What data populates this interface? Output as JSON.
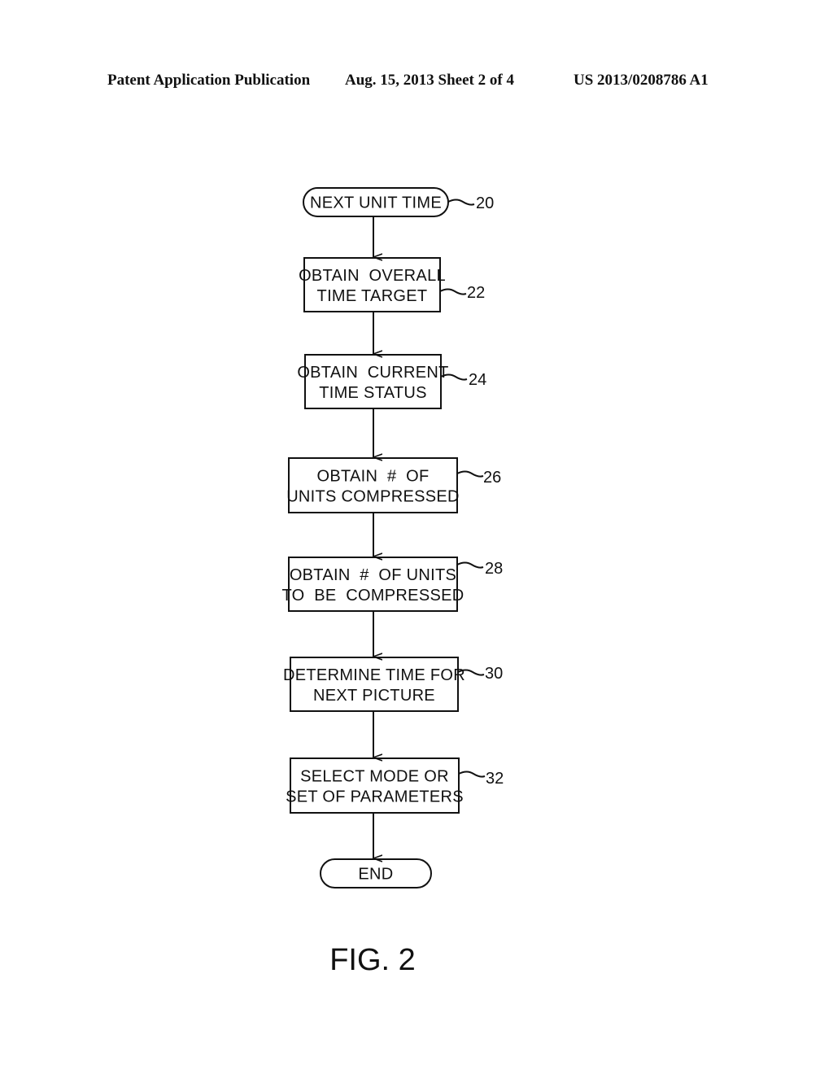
{
  "header": {
    "publication": "Patent Application Publication",
    "date_sheet": "Aug. 15, 2013  Sheet 2 of 4",
    "number": "US 2013/0208786 A1"
  },
  "flowchart": {
    "nodes": [
      {
        "id": "20",
        "type": "terminal",
        "lines": [
          "NEXT UNIT TIME"
        ],
        "ref": "20"
      },
      {
        "id": "22",
        "type": "process",
        "lines": [
          "OBTAIN  OVERALL",
          "TIME TARGET"
        ],
        "ref": "22"
      },
      {
        "id": "24",
        "type": "process",
        "lines": [
          "OBTAIN  CURRENT",
          "TIME STATUS"
        ],
        "ref": "24"
      },
      {
        "id": "26",
        "type": "process",
        "lines": [
          "OBTAIN  #  OF",
          "UNITS COMPRESSED"
        ],
        "ref": "26"
      },
      {
        "id": "28",
        "type": "process",
        "lines": [
          "OBTAIN  #  OF UNITS",
          "TO  BE  COMPRESSED"
        ],
        "ref": "28"
      },
      {
        "id": "30",
        "type": "process",
        "lines": [
          "DETERMINE TIME FOR",
          "NEXT PICTURE"
        ],
        "ref": "30"
      },
      {
        "id": "32",
        "type": "process",
        "lines": [
          "SELECT MODE OR",
          "SET OF PARAMETERS"
        ],
        "ref": "32"
      },
      {
        "id": "end",
        "type": "terminal",
        "lines": [
          "END"
        ],
        "ref": ""
      }
    ],
    "edges": [
      [
        "20",
        "22"
      ],
      [
        "22",
        "24"
      ],
      [
        "24",
        "26"
      ],
      [
        "26",
        "28"
      ],
      [
        "28",
        "30"
      ],
      [
        "30",
        "32"
      ],
      [
        "32",
        "end"
      ]
    ]
  },
  "figure_label": "FIG. 2"
}
